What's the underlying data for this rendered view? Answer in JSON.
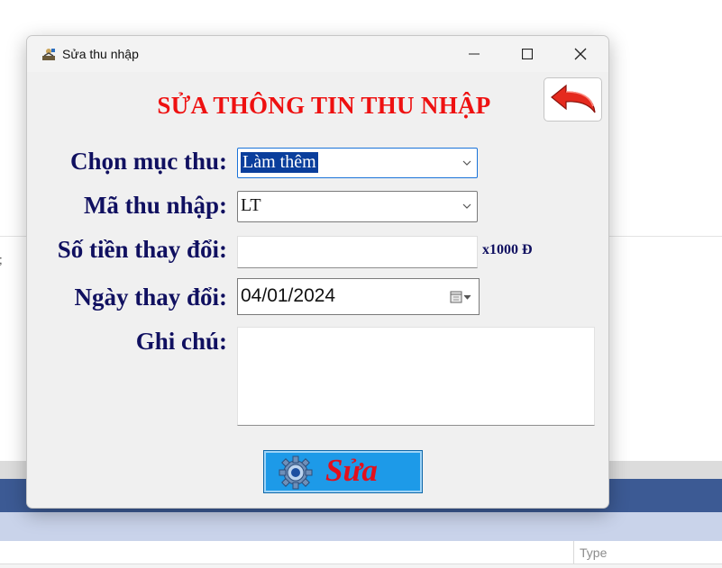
{
  "background": {
    "fragment_text": ";",
    "table_header": "Type"
  },
  "window": {
    "title": "Sửa thu nhập",
    "controls": {
      "minimize": "minimize",
      "maximize": "maximize",
      "close": "close"
    }
  },
  "form": {
    "title": "SỬA THÔNG TIN THU NHẬP",
    "back_icon": "back-arrow-icon",
    "category_label": "Chọn mục thu:",
    "category_value": "Làm thêm",
    "code_label": "Mã thu nhập:",
    "code_value": "LT",
    "amount_label": "Số tiền thay đổi:",
    "amount_value": "",
    "amount_unit": "x1000 Đ",
    "date_label": "Ngày thay đổi:",
    "date_value": "04/01/2024",
    "note_label": "Ghi chú:",
    "note_value": "",
    "save_label": "Sửa"
  },
  "colors": {
    "title_red": "#ee1111",
    "label_navy": "#101060",
    "save_button_blue": "#1d9ae8"
  }
}
